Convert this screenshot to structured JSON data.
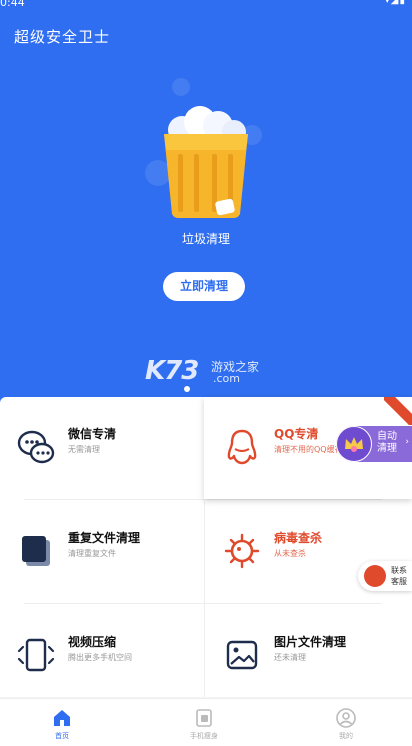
{
  "status_bar": {
    "time": "0:44"
  },
  "app": {
    "title": "超级安全卫士"
  },
  "hero": {
    "label": "垃圾清理",
    "button_label": "立即清理",
    "watermark_main": "K73",
    "watermark_sub": "游戏之家",
    "watermark_domain": ".com",
    "background_color": "#2f6ef0"
  },
  "features": [
    {
      "title": "微信专清",
      "subtitle": "无需清理",
      "icon": "wechat-icon",
      "color": "#1f2d4d"
    },
    {
      "title": "QQ专清",
      "subtitle": "清理不用的QQ缓存",
      "icon": "qq-penguin-icon",
      "color": "#e04a2c"
    },
    {
      "title": "重复文件清理",
      "subtitle": "清理重复文件",
      "icon": "duplicate-files-icon",
      "color": "#1f2d4d"
    },
    {
      "title": "病毒查杀",
      "subtitle": "从未查杀",
      "icon": "virus-icon",
      "color": "#e04a2c"
    },
    {
      "title": "视频压缩",
      "subtitle": "腾出更多手机空间",
      "icon": "video-compress-icon",
      "color": "#1f2d4d"
    },
    {
      "title": "图片文件清理",
      "subtitle": "还未清理",
      "icon": "image-file-icon",
      "color": "#1f2d4d"
    }
  ],
  "auto_clean": {
    "label": "自动清理"
  },
  "contact": {
    "label": "联系客服"
  },
  "tabs": [
    {
      "label": "首页",
      "icon": "home-icon",
      "active": true
    },
    {
      "label": "手机瘦身",
      "icon": "phone-slim-icon",
      "active": false
    },
    {
      "label": "我的",
      "icon": "profile-icon",
      "active": false
    }
  ],
  "accent_color": "#2f6ef0"
}
